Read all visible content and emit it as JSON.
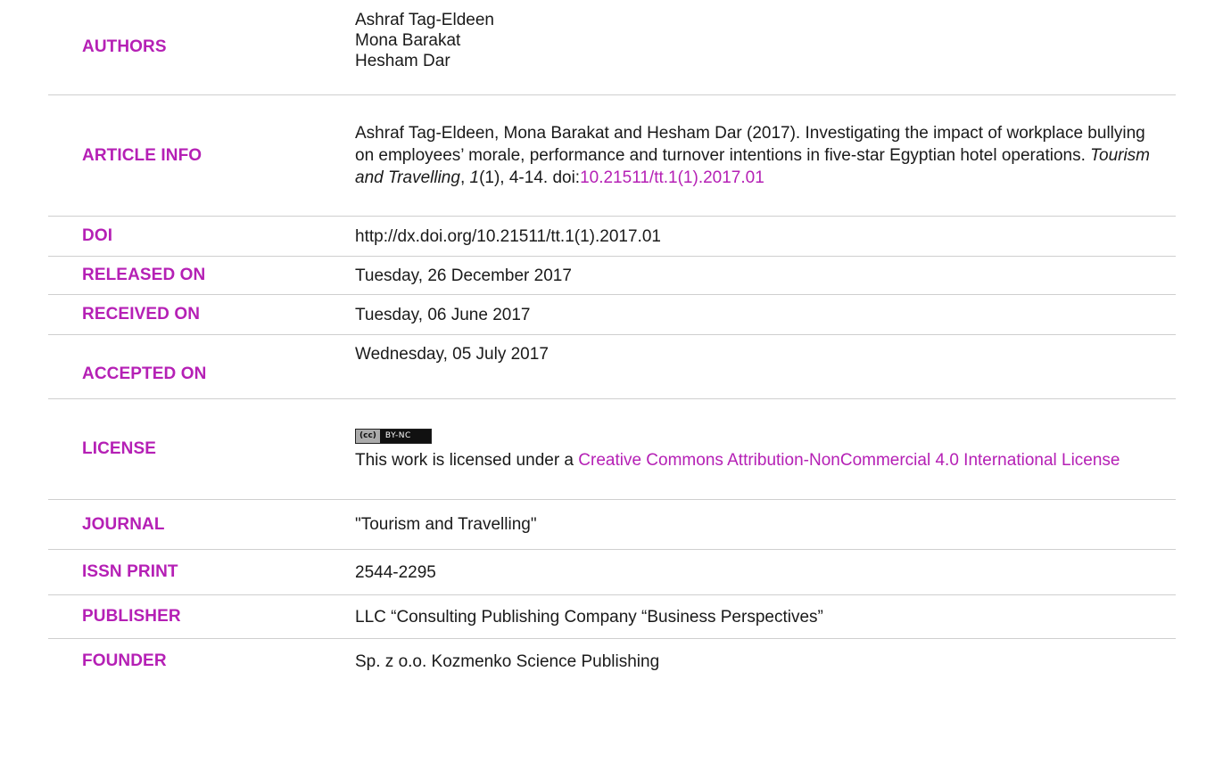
{
  "authors": {
    "label": "AUTHORS",
    "names": [
      "Ashraf Tag-Eldeen",
      "Mona Barakat",
      "Hesham Dar"
    ]
  },
  "article_info": {
    "label": "ARTICLE INFO",
    "citation_text": "Ashraf Tag-Eldeen, Mona Barakat and Hesham Dar (2017). Investigating the impact of workplace bullying on employees’ morale, performance and turnover intentions in five-star Egyptian hotel operations. ",
    "journal_italic": "Tourism and Travelling",
    "comma1": ", ",
    "volume_italic": "1",
    "issue_pages": "(1), 4-14. doi:",
    "doi_link": "10.21511/tt.1(1).2017.01"
  },
  "doi": {
    "label": "DOI",
    "value": "http://dx.doi.org/10.21511/tt.1(1).2017.01"
  },
  "released_on": {
    "label": "RELEASED ON",
    "value": "Tuesday, 26 December 2017"
  },
  "received_on": {
    "label": "RECEIVED ON",
    "value": "Tuesday, 06 June 2017"
  },
  "accepted_on": {
    "label": "ACCEPTED ON",
    "value": "Wednesday, 05 July 2017"
  },
  "license": {
    "label": "LICENSE",
    "badge_cc": "(cc)",
    "badge_text": "BY-NC",
    "text_prefix": "This work is licensed under a ",
    "link_text": "Creative Commons Attribution-NonCommercial 4.0 International License"
  },
  "journal": {
    "label": "JOURNAL",
    "value": "\"Tourism and Travelling\""
  },
  "issn_print": {
    "label": "ISSN PRINT",
    "value": "2544-2295"
  },
  "publisher": {
    "label": "PUBLISHER",
    "value": "LLC “Consulting Publishing Company “Business Perspectives”"
  },
  "founder": {
    "label": "FOUNDER",
    "value": "Sp. z o.o. Kozmenko Science Publishing"
  },
  "colors": {
    "accent": "#b520b5",
    "text": "#1a1a1a",
    "divider": "#cfcfcf"
  }
}
